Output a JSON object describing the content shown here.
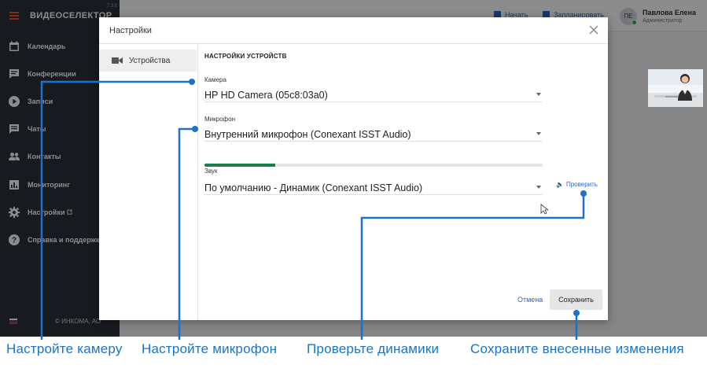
{
  "app": {
    "brand": "ВИДЕОСЕЛЕКТОР",
    "version": "7.3.0",
    "copyright": "© ИНКОМА, АО",
    "colors": {
      "sidebar": "#2b3038",
      "accent": "#2a66c4",
      "level": "#1e7b4c",
      "caption": "#1a73c9"
    }
  },
  "sidebar": {
    "items": [
      {
        "label": "Календарь",
        "icon": "calendar-icon"
      },
      {
        "label": "Конференции",
        "icon": "chat-icon"
      },
      {
        "label": "Записи",
        "icon": "play-icon"
      },
      {
        "label": "Чаты",
        "icon": "message-icon"
      },
      {
        "label": "Контакты",
        "icon": "people-icon"
      },
      {
        "label": "Мониторинг",
        "icon": "chart-icon"
      },
      {
        "label": "Настройки",
        "icon": "gear-icon"
      },
      {
        "label": "Справка и поддержка",
        "icon": "help-icon"
      }
    ]
  },
  "topbar": {
    "start_label": "Начать",
    "schedule_label": "Запланировать",
    "avatar_initials": "ПЕ",
    "user_name": "Павлова Елена",
    "user_role": "Администратор"
  },
  "modal": {
    "title": "Настройки",
    "nav_devices": "Устройства",
    "section_title": "НАСТРОЙКИ УСТРОЙСТВ",
    "camera": {
      "label": "Камера",
      "value": "HP HD Camera (05c8:03a0)"
    },
    "microphone": {
      "label": "Микрофон",
      "value": "Внутренний микрофон (Conexant ISST Audio)",
      "level": 0.21
    },
    "sound": {
      "label": "Звук",
      "value": "По умолчанию - Динамик (Conexant ISST Audio)",
      "check_label": "Проверить"
    },
    "cancel_label": "Отмена",
    "save_label": "Сохранить"
  },
  "callouts": {
    "camera": "Настройте камеру",
    "microphone": "Настройте микрофон",
    "speakers": "Проверьте динамики",
    "save": "Сохраните внесенные изменения"
  }
}
